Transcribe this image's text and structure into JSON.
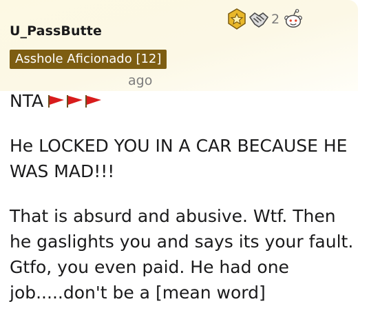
{
  "comment": {
    "author": "U_PassButte",
    "flair": "Asshole Aficionado [12]",
    "timestamp": "ago",
    "awards": [
      {
        "icon": "gold-star-award-icon"
      },
      {
        "icon": "wholesome-handshake-award-icon",
        "count": "2"
      },
      {
        "icon": "snoo-award-icon"
      }
    ],
    "body": {
      "verdict": "NTA",
      "verdict_icons": [
        "red-flag-icon",
        "red-flag-icon",
        "red-flag-icon"
      ],
      "paragraph_2": "He LOCKED YOU IN A CAR BECAUSE HE WAS MAD!!!",
      "paragraph_3": "That is absurd and abusive. Wtf. Then he gaslights you and says its your fault. Gtfo, you even paid. He had one job.....don't be a [mean word]"
    },
    "colors": {
      "highlight": "#fcf8e6",
      "flair_bg": "#7d5d12",
      "flair_text": "#ffffff",
      "flag_red": "#d81c1c",
      "muted_text": "#7c7c7c"
    }
  }
}
